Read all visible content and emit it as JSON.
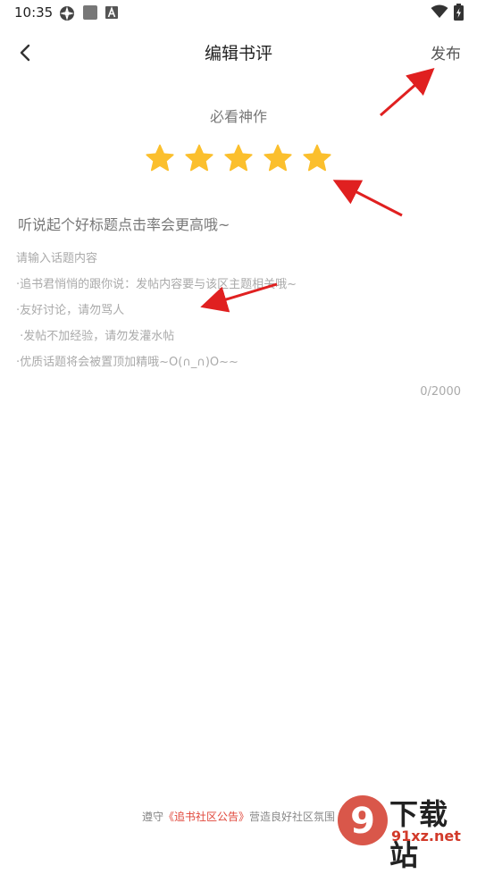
{
  "status_bar": {
    "time": "10:35",
    "icons": [
      "settings-sync-icon",
      "app-square-icon",
      "notification-a-icon",
      "wifi-icon",
      "battery-icon"
    ]
  },
  "header": {
    "back_icon": "chevron-left-icon",
    "title": "编辑书评",
    "publish_label": "发布"
  },
  "rating": {
    "label": "必看神作",
    "value": 5,
    "max": 5,
    "star_color": "#fbbf2d"
  },
  "title_input": {
    "value": "",
    "placeholder": "听说起个好标题点击率会更高哦~"
  },
  "content": {
    "placeholder_lines": [
      "请输入话题内容",
      "·追书君悄悄的跟你说：发帖内容要与该区主题相关哦~",
      "·友好讨论，请勿骂人",
      " ·发帖不加经验，请勿发灌水帖",
      "·优质话题将会被置顶加精哦~O(∩_∩)O~~"
    ],
    "counter": "0/2000"
  },
  "footer": {
    "prefix": "遵守",
    "link": "《追书社区公告》",
    "suffix": "营造良好社区氛围"
  },
  "watermark": {
    "logo_text": "9",
    "text": "下载站",
    "url": "91xz.net"
  },
  "annotation_color": "#e02020"
}
